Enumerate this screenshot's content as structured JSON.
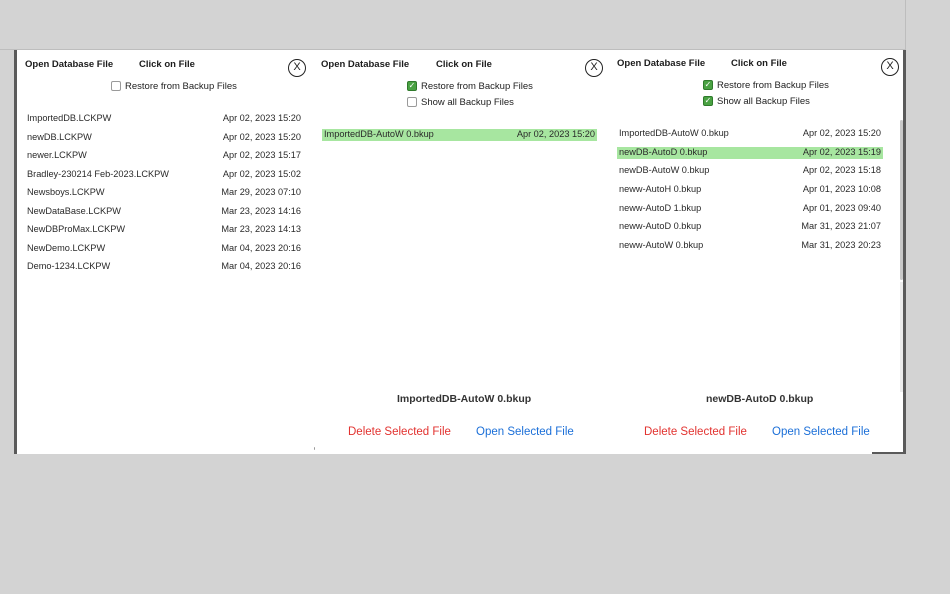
{
  "panel1": {
    "title": "Open Database File",
    "subtitle": "Click on File",
    "close_glyph": "X",
    "restore_label": "Restore from Backup Files",
    "restore_checked": false,
    "files": [
      {
        "name": "ImportedDB.LCKPW",
        "date": "Apr 02, 2023 15:20"
      },
      {
        "name": "newDB.LCKPW",
        "date": "Apr 02, 2023 15:20"
      },
      {
        "name": "newer.LCKPW",
        "date": "Apr 02, 2023 15:17"
      },
      {
        "name": "Bradley-230214 Feb-2023.LCKPW",
        "date": "Apr 02, 2023 15:02"
      },
      {
        "name": "Newsboys.LCKPW",
        "date": "Mar 29, 2023 07:10"
      },
      {
        "name": "NewDataBase.LCKPW",
        "date": "Mar 23, 2023 14:16"
      },
      {
        "name": "NewDBProMax.LCKPW",
        "date": "Mar 23, 2023 14:13"
      },
      {
        "name": "NewDemo.LCKPW",
        "date": "Mar 04, 2023 20:16"
      },
      {
        "name": "Demo-1234.LCKPW",
        "date": "Mar 04, 2023 20:16"
      }
    ]
  },
  "panel2": {
    "title": "Open Database File",
    "subtitle": "Click on File",
    "close_glyph": "X",
    "restore_label": "Restore from Backup Files",
    "restore_checked": true,
    "show_all_label": "Show all Backup Files",
    "show_all_checked": false,
    "files": [
      {
        "name": "ImportedDB-AutoW 0.bkup",
        "date": "Apr 02, 2023 15:20",
        "selected": true
      }
    ],
    "selected_file": "ImportedDB-AutoW 0.bkup",
    "delete_label": "Delete Selected File",
    "open_label": "Open Selected File"
  },
  "panel3": {
    "title": "Open Database File",
    "subtitle": "Click on File",
    "close_glyph": "X",
    "restore_label": "Restore from Backup Files",
    "restore_checked": true,
    "show_all_label": "Show all Backup Files",
    "show_all_checked": true,
    "files": [
      {
        "name": "ImportedDB-AutoW 0.bkup",
        "date": "Apr 02, 2023 15:20"
      },
      {
        "name": "newDB-AutoD 0.bkup",
        "date": "Apr 02, 2023 15:19",
        "selected": true
      },
      {
        "name": "newDB-AutoW 0.bkup",
        "date": "Apr 02, 2023 15:18"
      },
      {
        "name": "neww-AutoH 0.bkup",
        "date": "Apr 01, 2023 10:08"
      },
      {
        "name": "neww-AutoD 1.bkup",
        "date": "Apr 01, 2023 09:40"
      },
      {
        "name": "neww-AutoD 0.bkup",
        "date": "Mar 31, 2023 21:07"
      },
      {
        "name": "neww-AutoW 0.bkup",
        "date": "Mar 31, 2023 20:23"
      }
    ],
    "selected_file": "newDB-AutoD 0.bkup",
    "delete_label": "Delete Selected File",
    "open_label": "Open Selected File"
  },
  "colors": {
    "selection": "#a7e6a0",
    "checkbox_on": "#4aa243",
    "delete": "#e2322f",
    "open": "#1b6fd8",
    "frame": "#5a5a5a",
    "background": "#d3d3d3"
  }
}
